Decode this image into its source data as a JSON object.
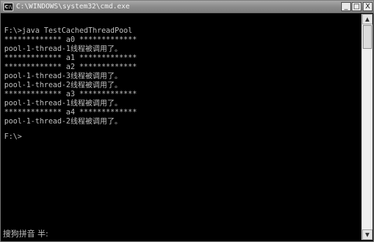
{
  "window": {
    "icon_label": "C:\\",
    "title": "C:\\WINDOWS\\system32\\cmd.exe",
    "minimize_label": "_",
    "maximize_label": "□",
    "close_label": "X"
  },
  "console": {
    "lines": [
      "",
      "F:\\>java TestCachedThreadPool",
      "************* a0 *************",
      "pool-1-thread-1线程被调用了。",
      "************* a1 *************",
      "************* a2 *************",
      "pool-1-thread-3线程被调用了。",
      "pool-1-thread-2线程被调用了。",
      "************* a3 *************",
      "pool-1-thread-1线程被调用了。",
      "************* a4 *************",
      "pool-1-thread-2线程被调用了。",
      "",
      "F:\\>"
    ]
  },
  "ime": {
    "status": "搜狗拼音 半:"
  },
  "scrollbar": {
    "up_label": "▲",
    "down_label": "▼"
  }
}
